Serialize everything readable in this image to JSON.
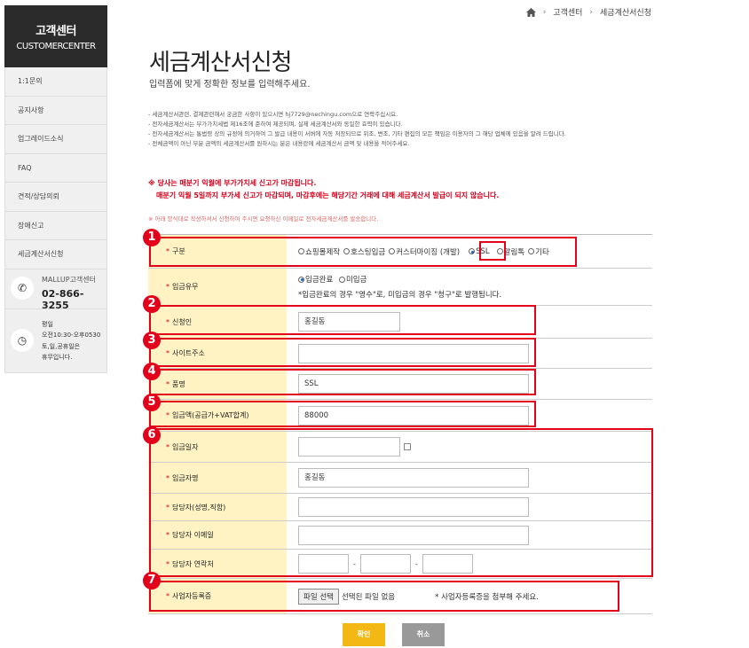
{
  "sidebar": {
    "title": "고객센터",
    "subtitle": "CUSTOMERCENTER",
    "items": [
      "1:1문의",
      "공지사항",
      "업그레이드소식",
      "FAQ",
      "견적/상담의뢰",
      "장애신고",
      "세금계산서신청"
    ],
    "contact_label": "MALLUP고객센터",
    "contact_phone": "02-866-3255",
    "hours": [
      "평일",
      "오전10:30-오후0530",
      "토,일,공휴일은",
      "휴무입니다."
    ]
  },
  "breadcrumb": {
    "items": [
      "고객센터",
      "세금계산서신청"
    ]
  },
  "page": {
    "title": "세금계산서신청",
    "subtitle": "입력폼에 맞게 정확한 정보를 입력해주세요."
  },
  "notices": [
    "- 세금계산서관련, 결제관련해서 궁금한 사항이 있으시면 hj7729@nechingu.com으로 연락주십시요.",
    "- 전자세금계산서는 부가가치세법 제16조에 준하여 제공되며, 실제 세금계산서와 동일한 효력이 있습니다.",
    "- 전자세금계산서는 통법령 상의 규정에 의거하여 그 발급 내용이 서버에 자동 저장되므로 위조, 변조, 기타 편집의 모든 책임은 이용자의 그 해당 업체에 있음을 알려 드립니다.",
    "- 전체금액이 아닌 부분 금액의 세금계산서를 원하시는 분은 내용란에 세금계산서 금액 및 내용을 적어주세요."
  ],
  "warning": {
    "line1": "※ 당사는 매분기 익월에 부가가치세 신고가 마감됩니다.",
    "line2": "매분기 익월 5일까지 부가세 신고가 마감되며, 마감후에는 해당기간 거래에 대해 세금계산서 발급이 되지 않습니다.",
    "line3": "※ 아래 양식대로 작성하셔서 신청하여 주시면 요청하신 이메일로 전자세금계산서를 발송합니다."
  },
  "form": {
    "req_mark": "*",
    "category": {
      "label": "구분",
      "options": [
        "쇼핑몰제작",
        "호스팅입금",
        "커스터마이징 (개발)",
        "SSL",
        "알림톡",
        "기타"
      ],
      "selected": "SSL"
    },
    "payment_status": {
      "label": "입금유무",
      "options": [
        "입금완료",
        "미입금"
      ],
      "selected": "입금완료",
      "note": "*입금완료의 경우 \"영수\"로, 미입금의 경우 \"청구\"로 발행됩니다."
    },
    "applicant": {
      "label": "신청인",
      "value": "홍길동"
    },
    "site_url": {
      "label": "사이트주소",
      "value": ""
    },
    "product": {
      "label": "품명",
      "value": "SSL"
    },
    "amount": {
      "label": "입금액(공급가+VAT합계)",
      "value": "88000"
    },
    "deposit_date": {
      "label": "입금일자",
      "value": ""
    },
    "depositor": {
      "label": "입금자명",
      "value": "홍길동"
    },
    "manager": {
      "label": "담당자(성명,직함)",
      "value": ""
    },
    "manager_email": {
      "label": "담당자 이메일",
      "value": ""
    },
    "manager_phone": {
      "label": "담당자 연락처",
      "parts": [
        "",
        "",
        ""
      ],
      "sep": "-"
    },
    "biz_license": {
      "label": "사업자등록증",
      "button": "파일 선택",
      "status": "선택된 파일 없음",
      "note": "* 사업자등록증을 첨부해 주세요."
    }
  },
  "annotations": [
    "1",
    "2",
    "3",
    "4",
    "5",
    "6",
    "7"
  ],
  "buttons": {
    "confirm": "확인",
    "cancel": "취소"
  },
  "colors": {
    "sidebar_head": "#2b2b2b",
    "label_bg": "#fff3c4",
    "annotation": "#e3001b",
    "confirm": "#f3b814",
    "cancel": "#999999"
  }
}
